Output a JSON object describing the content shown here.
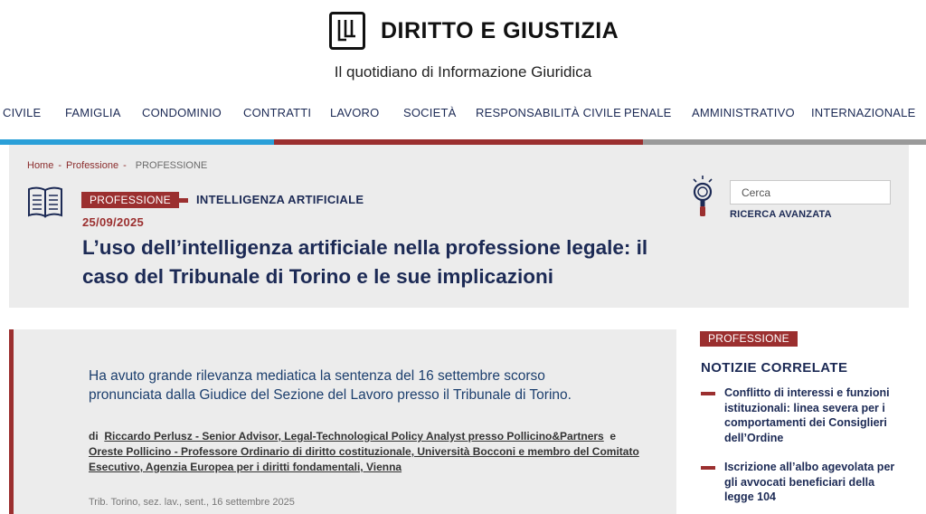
{
  "header": {
    "logo_mark": "JL",
    "site_title": "DIRITTO E GIUSTIZIA",
    "tagline": "Il quotidiano di Informazione Giuridica"
  },
  "nav": {
    "items": [
      "CIVILE",
      "FAMIGLIA",
      "CONDOMINIO",
      "CONTRATTI",
      "LAVORO",
      "SOCIETÀ",
      "RESPONSABILITÀ CIVILE",
      "PENALE",
      "AMMINISTRATIVO",
      "INTERNAZIONALE"
    ],
    "bar_colors": [
      "#2a9fd8",
      "#9b2f2f",
      "#9a9a9a"
    ]
  },
  "breadcrumb": {
    "home": "Home",
    "section": "Professione",
    "current": "PROFESSIONE",
    "separator": "-"
  },
  "article": {
    "category_badge": "PROFESSIONE",
    "topic": "INTELLIGENZA ARTIFICIALE",
    "date": "25/09/2025",
    "title": "L’uso dell’intelligenza artificiale nella professione legale: il caso del Tribunale di Torino e le sue implicazioni",
    "lead": "Ha avuto grande rilevanza mediatica la sentenza del 16 settembre scorso pronunciata dalla Giudice del Sezione del Lavoro presso il Tribunale di Torino.",
    "authors_prefix": "di",
    "author_1": "Riccardo Perlusz - Senior Advisor, Legal-Technological Policy Analyst presso Pollicino&Partners",
    "authors_joiner": "e",
    "author_2": "Oreste Pollicino - Professore Ordinario di diritto costituzionale, Università Bocconi e membro del Comitato Esecutivo, Agenzia Europea per i diritti fondamentali, Vienna",
    "source": "Trib. Torino, sez. lav., sent., 16 settembre 2025"
  },
  "search": {
    "placeholder": "Cerca",
    "advanced_label": "RICERCA AVANZATA",
    "icon": "magnifier-bulb-icon"
  },
  "sidebar": {
    "badge": "PROFESSIONE",
    "title": "NOTIZIE CORRELATE",
    "items": [
      "Conflitto di interessi e funzioni istituzionali: linea severa per i comportamenti dei Consiglieri dell’Ordine",
      "Iscrizione all’albo agevolata per gli avvocati beneficiari della legge 104"
    ]
  },
  "colors": {
    "navy": "#1c2a55",
    "accent_red": "#9b2f2f",
    "panel_gray": "#ececec"
  }
}
